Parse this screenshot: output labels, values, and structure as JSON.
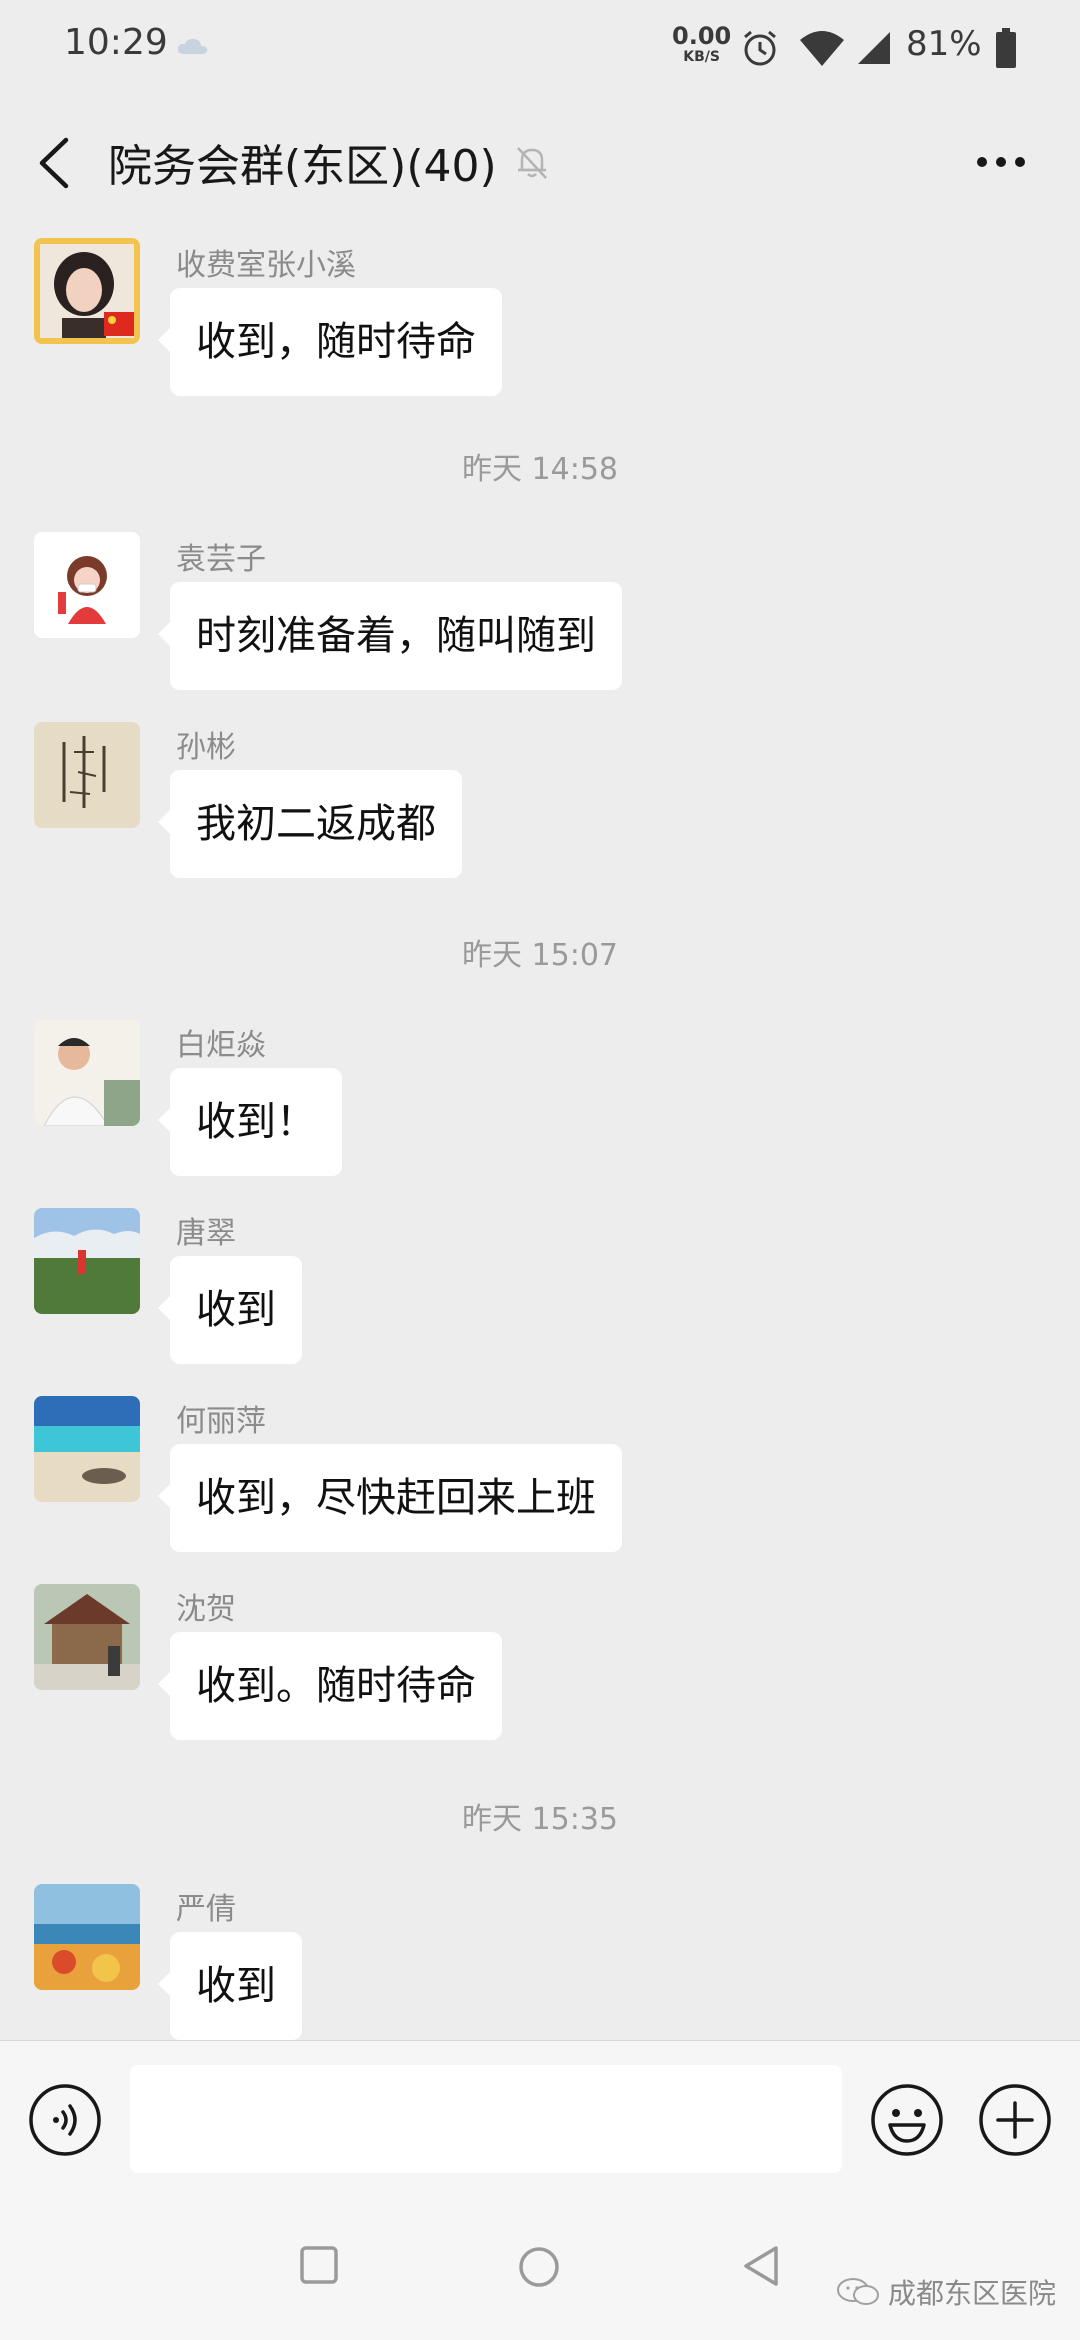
{
  "status_bar": {
    "time": "10:29",
    "net_speed_value": "0.00",
    "net_speed_unit": "KB/S",
    "battery_percent": "81%"
  },
  "header": {
    "title": "院务会群(东区)(40)"
  },
  "messages": [
    {
      "sender": "收费室张小溪",
      "text": "收到，随时待命"
    },
    {
      "sender": "袁芸子",
      "text": "时刻准备着，随叫随到"
    },
    {
      "sender": "孙彬",
      "text": "我初二返成都"
    },
    {
      "sender": "白炬焱",
      "text": "收到！"
    },
    {
      "sender": "唐翠",
      "text": "收到"
    },
    {
      "sender": "何丽萍",
      "text": "收到，尽快赶回来上班"
    },
    {
      "sender": "沈贺",
      "text": "收到。随时待命"
    },
    {
      "sender": "严倩",
      "text": "收到"
    }
  ],
  "timestamps": [
    "昨天 14:58",
    "昨天 15:07",
    "昨天 15:35"
  ],
  "input": {
    "value": "",
    "placeholder": ""
  },
  "watermark": {
    "text": "成都东区医院"
  },
  "colors": {
    "background": "#ededed",
    "bubble": "#ffffff",
    "sender_name": "#8b8b8b",
    "timestamp": "#9a9a9a"
  }
}
